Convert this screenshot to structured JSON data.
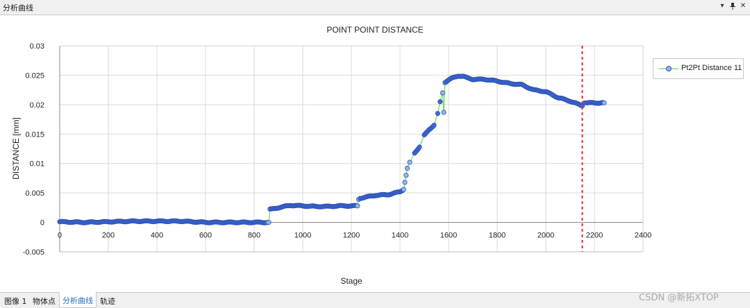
{
  "panel": {
    "title": "分析曲线",
    "pin_icon": "pin-icon",
    "close_icon": "close-icon",
    "dropdown_icon": "chevron-down-icon"
  },
  "tabs": [
    {
      "label": "图像 1",
      "active": false
    },
    {
      "label": "物体点",
      "active": false
    },
    {
      "label": "分析曲线",
      "active": true
    },
    {
      "label": "轨迹",
      "active": false
    }
  ],
  "watermark": "CSDN @新拓XTOP",
  "colors": {
    "marker_fill": "#4169d4",
    "marker_stroke": "#2f56b8",
    "line": "#66dd55",
    "highlight_marker": "#8fb6e8",
    "cursor_line": "#ee2222",
    "grid": "#d9d9d9"
  },
  "chart_data": {
    "type": "line",
    "title": "POINT POINT DISTANCE",
    "xlabel": "Stage",
    "ylabel": "DISTANCE [mm]",
    "xlim": [
      0,
      2400
    ],
    "ylim": [
      -0.005,
      0.03
    ],
    "x_ticks": [
      0,
      200,
      400,
      600,
      800,
      1000,
      1200,
      1400,
      1600,
      1800,
      2000,
      2200,
      2400
    ],
    "x_tick_labels": [
      "0",
      "200",
      "400",
      "600",
      "800",
      "1000",
      "1200",
      "1400",
      "1600",
      "1800",
      "2000",
      "2200",
      "2400"
    ],
    "y_ticks": [
      -0.005,
      0,
      0.005,
      0.01,
      0.015,
      0.02,
      0.025,
      0.03
    ],
    "y_tick_labels": [
      "-0.005",
      "0",
      "0.005",
      "0.01",
      "0.015",
      "0.02",
      "0.025",
      "0.03"
    ],
    "grid": true,
    "legend": "top-right-outside",
    "cursor_x": 2150,
    "series": [
      {
        "name": "Pt2Pt Distance 11",
        "x": [
          0,
          100,
          200,
          300,
          400,
          500,
          600,
          700,
          800,
          855,
          860,
          865,
          880,
          900,
          950,
          1000,
          1050,
          1100,
          1150,
          1200,
          1225,
          1230,
          1235,
          1260,
          1300,
          1350,
          1400,
          1415,
          1420,
          1425,
          1430,
          1440,
          1460,
          1480,
          1500,
          1520,
          1540,
          1555,
          1565,
          1575,
          1580,
          1585,
          1600,
          1620,
          1640,
          1660,
          1680,
          1700,
          1750,
          1800,
          1850,
          1900,
          1950,
          2000,
          2050,
          2100,
          2150,
          2160,
          2170,
          2200,
          2240
        ],
        "y": [
          0.0001,
          0.0,
          0.0001,
          0.0002,
          0.0002,
          0.0002,
          0.0,
          0.0,
          0.0,
          0.0,
          0.0,
          0.0022,
          0.0023,
          0.0025,
          0.0029,
          0.0028,
          0.0027,
          0.0027,
          0.0028,
          0.0028,
          0.0028,
          0.0039,
          0.0041,
          0.0043,
          0.0046,
          0.0047,
          0.0052,
          0.0056,
          0.0068,
          0.008,
          0.0092,
          0.0102,
          0.0118,
          0.0128,
          0.0148,
          0.0158,
          0.0165,
          0.0185,
          0.0205,
          0.022,
          0.0187,
          0.0238,
          0.0242,
          0.0246,
          0.0249,
          0.0248,
          0.0245,
          0.0243,
          0.0243,
          0.024,
          0.0236,
          0.0234,
          0.0225,
          0.0222,
          0.0212,
          0.0206,
          0.0198,
          0.0203,
          0.0203,
          0.0203,
          0.0203
        ]
      }
    ]
  }
}
